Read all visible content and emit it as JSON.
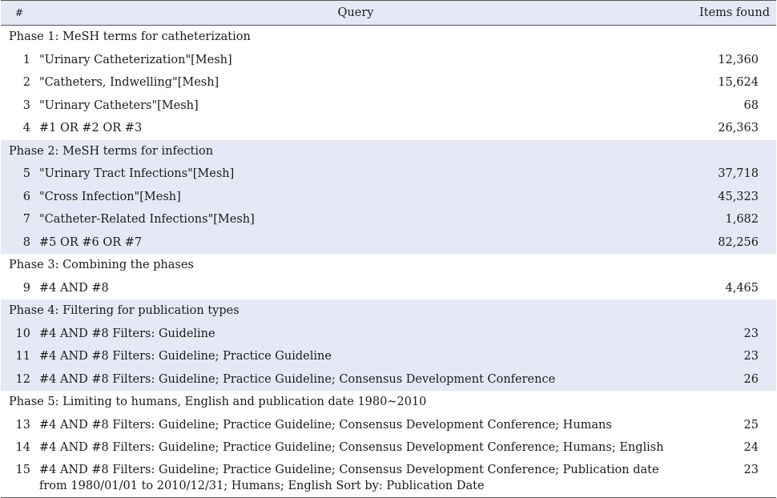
{
  "header": {
    "num": "#",
    "query": "Query",
    "items": "Items found"
  },
  "phases": [
    {
      "label": "Phase 1: MeSH terms for catheterization",
      "rows": [
        {
          "num": "1",
          "query": "\"Urinary Catheterization\"[Mesh]",
          "items": "12,360"
        },
        {
          "num": "2",
          "query": "\"Catheters, Indwelling\"[Mesh]",
          "items": "15,624"
        },
        {
          "num": "3",
          "query": "\"Urinary Catheters\"[Mesh]",
          "items": "68"
        },
        {
          "num": "4",
          "query": "#1 OR #2 OR #3",
          "items": "26,363"
        }
      ]
    },
    {
      "label": "Phase 2: MeSH terms for infection",
      "rows": [
        {
          "num": "5",
          "query": "\"Urinary Tract Infections\"[Mesh]",
          "items": "37,718"
        },
        {
          "num": "6",
          "query": "\"Cross Infection\"[Mesh]",
          "items": "45,323"
        },
        {
          "num": "7",
          "query": "\"Catheter-Related Infections\"[Mesh]",
          "items": "1,682"
        },
        {
          "num": "8",
          "query": "#5 OR #6 OR #7",
          "items": "82,256"
        }
      ]
    },
    {
      "label": "Phase 3: Combining the phases",
      "rows": [
        {
          "num": "9",
          "query": "#4 AND #8",
          "items": "4,465"
        }
      ]
    },
    {
      "label": "Phase 4: Filtering for publication types",
      "rows": [
        {
          "num": "10",
          "query": "#4 AND #8 Filters: Guideline",
          "items": "23"
        },
        {
          "num": "11",
          "query": "#4 AND #8 Filters: Guideline; Practice Guideline",
          "items": "23"
        },
        {
          "num": "12",
          "query": "#4 AND #8 Filters: Guideline; Practice Guideline; Consensus Development Conference",
          "items": "26"
        }
      ]
    },
    {
      "label": "Phase 5: Limiting to humans, English and publication date 1980~2010",
      "rows": [
        {
          "num": "13",
          "query": "#4 AND #8 Filters: Guideline; Practice Guideline; Consensus Development Conference; Humans",
          "items": "25"
        },
        {
          "num": "14",
          "query": "#4 AND #8 Filters: Guideline; Practice Guideline; Consensus Development Conference; Humans; English",
          "items": "24"
        },
        {
          "num": "15",
          "query": "#4 AND #8 Filters: Guideline; Practice Guideline; Consensus Development Conference; Publication date from 1980/01/01 to 2010/12/31; Humans; English Sort by: Publication Date",
          "items": "23"
        }
      ]
    }
  ]
}
